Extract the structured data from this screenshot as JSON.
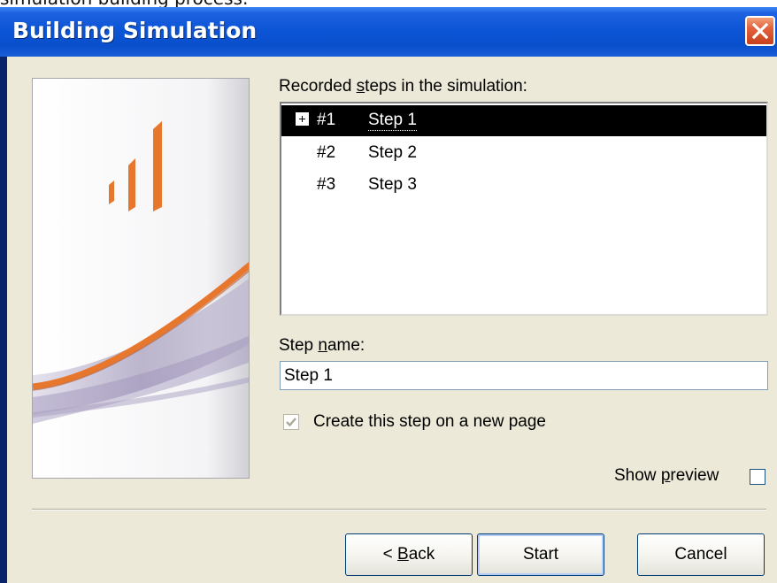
{
  "page_caption": "simulation building process:",
  "window": {
    "title": "Building Simulation",
    "close_icon": "close-icon"
  },
  "steps_label": {
    "before": "Recorded ",
    "mnemonic": "s",
    "after": "teps in the simulation:"
  },
  "steps": [
    {
      "number": "#1",
      "name": "Step 1",
      "selected": true
    },
    {
      "number": "#2",
      "name": "Step 2",
      "selected": false
    },
    {
      "number": "#3",
      "name": "Step 3",
      "selected": false
    }
  ],
  "step_name": {
    "label_before": "Step ",
    "label_mnemonic": "n",
    "label_after": "ame:",
    "value": "Step 1"
  },
  "new_page_checkbox": {
    "label": "Create this step on a new page",
    "checked": true,
    "enabled": false
  },
  "show_preview": {
    "label_before": "Show ",
    "label_mnemonic": "p",
    "label_after": "review",
    "checked": false
  },
  "buttons": {
    "back_prefix": "< ",
    "back_mnemonic": "B",
    "back_rest": "ack",
    "start": "Start",
    "cancel": "Cancel"
  },
  "colors": {
    "titlebar": "#0b55d6",
    "accent_orange": "#e8772e",
    "dialog_bg": "#ece9d8"
  }
}
